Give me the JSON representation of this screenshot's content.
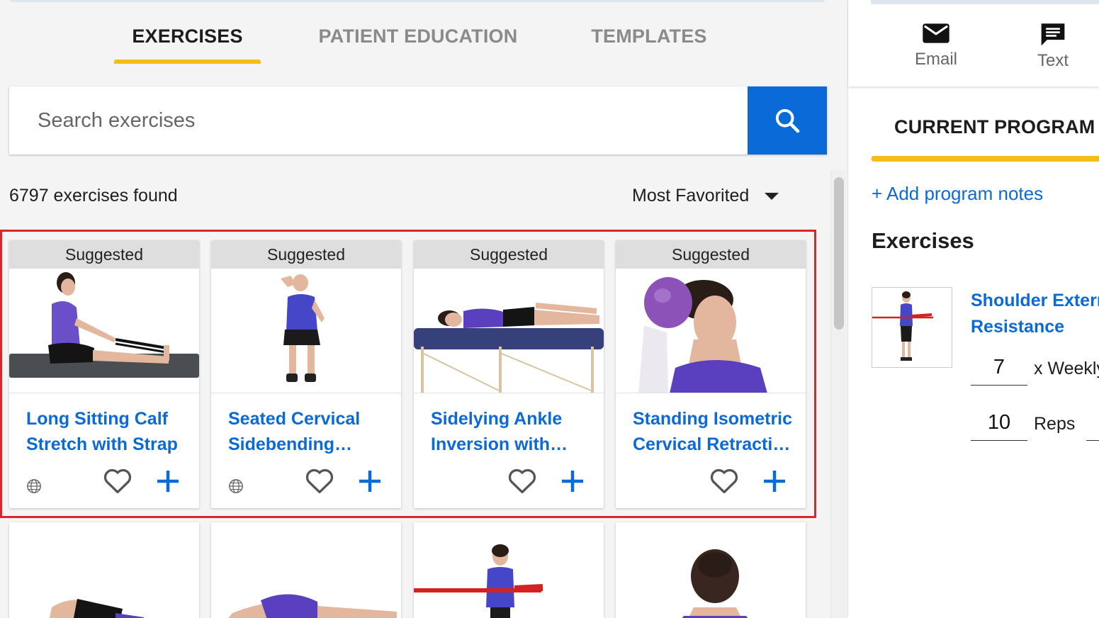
{
  "tabs": [
    {
      "label": "EXERCISES",
      "active": true
    },
    {
      "label": "PATIENT EDUCATION",
      "active": false
    },
    {
      "label": "TEMPLATES",
      "active": false
    }
  ],
  "search": {
    "placeholder": "Search exercises",
    "icon": "search-icon"
  },
  "results": {
    "count_label": "6797 exercises found",
    "sort_label": "Most Favorited"
  },
  "cards": [
    {
      "badge": "Suggested",
      "title": "Long Sitting Calf Stretch with Strap",
      "title_display": "Long Sitting Calf Stretch with Strap",
      "has_globe": true
    },
    {
      "badge": "Suggested",
      "title": "Seated Cervical Sidebending…",
      "title_display": "Seated Cervical Sidebending…",
      "has_globe": true
    },
    {
      "badge": "Suggested",
      "title": "Sidelying Ankle Inversion with…",
      "title_display": "Sidelying Ankle Inversion with…",
      "has_globe": false
    },
    {
      "badge": "Suggested",
      "title": "Standing Isometric Cervical Retracti…",
      "title_display": "Standing Isometric Cervical Retracti…",
      "has_globe": false
    }
  ],
  "share": {
    "email_label": "Email",
    "text_label": "Text"
  },
  "program": {
    "tab_label": "CURRENT PROGRAM",
    "add_notes": "+ Add program notes",
    "exercises_heading": "Exercises",
    "exercise": {
      "name_line1": "Shoulder Exterr",
      "name_line2": "Resistance",
      "frequency_value": "7",
      "frequency_label": "x Weekly",
      "reps_value": "10",
      "reps_label": "Reps"
    }
  },
  "colors": {
    "accent": "#0a6ad8",
    "tab_indicator": "#f6bd16",
    "highlight_border": "#d9262c"
  }
}
